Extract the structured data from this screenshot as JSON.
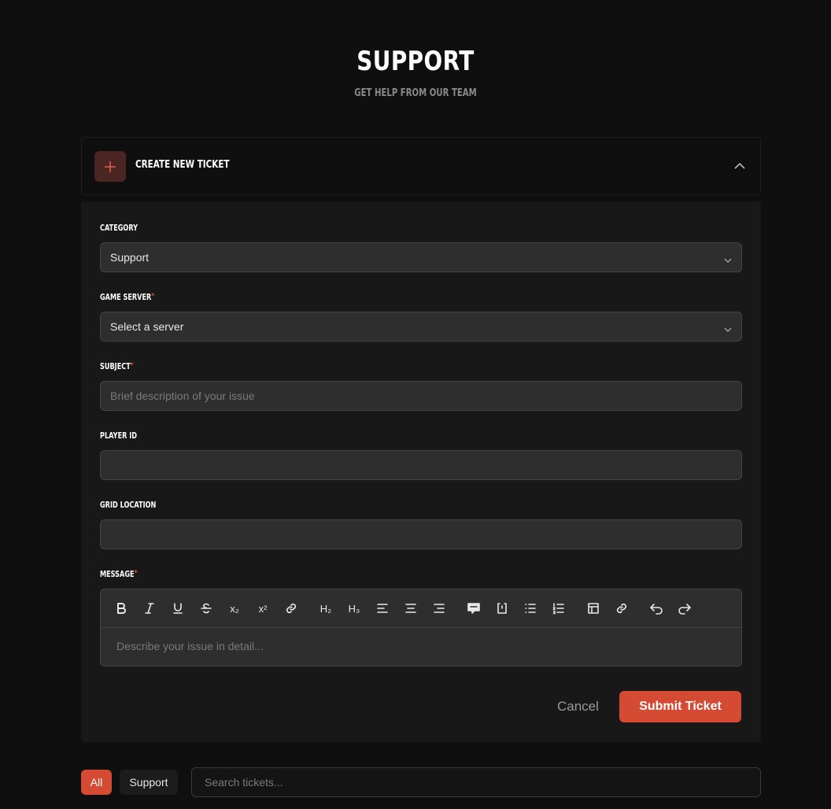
{
  "header": {
    "title": "SUPPORT",
    "subtitle": "GET HELP FROM OUR TEAM"
  },
  "ticket_panel": {
    "title": "CREATE NEW TICKET",
    "expanded": true
  },
  "form": {
    "category": {
      "label": "CATEGORY",
      "value": "Support"
    },
    "game_server": {
      "label": "GAME SERVER",
      "required_mark": "*",
      "value": "Select a server"
    },
    "subject": {
      "label": "SUBJECT",
      "required_mark": "*",
      "placeholder": "Brief description of your issue"
    },
    "player_id": {
      "label": "PLAYER ID",
      "value": ""
    },
    "grid_location": {
      "label": "GRID LOCATION",
      "value": ""
    },
    "message": {
      "label": "MESSAGE",
      "required_mark": "*",
      "placeholder": "Describe your issue in detail..."
    },
    "toolbar": {
      "h2": "H₂",
      "h3": "H₃",
      "subscript": "x₂",
      "superscript": "x²"
    },
    "cancel_label": "Cancel",
    "submit_label": "Submit Ticket"
  },
  "filters": {
    "all_label": "All",
    "support_label": "Support",
    "search_placeholder": "Search tickets..."
  },
  "colors": {
    "accent": "#d44a33",
    "background": "#0f0f0f",
    "panel": "#181818",
    "field": "#2e2e2e"
  }
}
